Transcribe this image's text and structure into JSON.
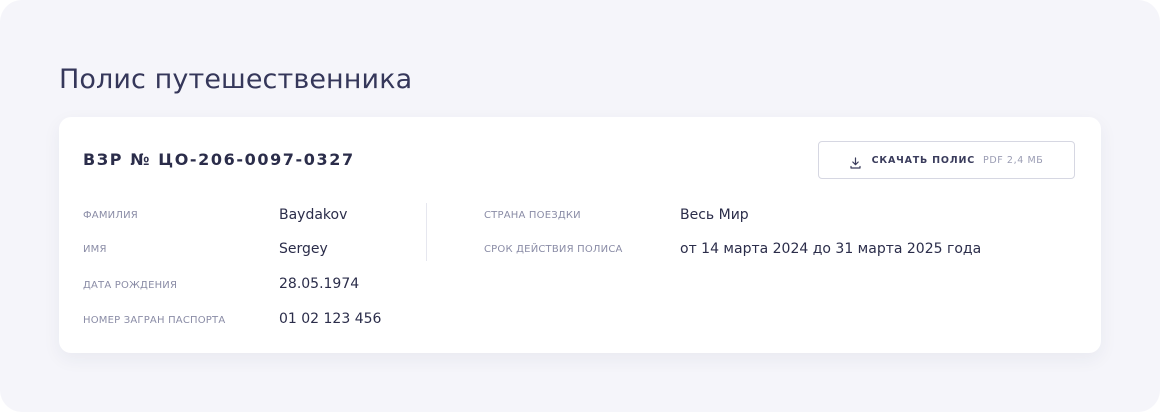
{
  "page": {
    "title": "Полис путешественника"
  },
  "policy": {
    "number": "ВЗР № ЦО-206-0097-0327",
    "download": {
      "label": "СКАЧАТЬ ПОЛИС",
      "meta": "PDF 2,4 МБ",
      "icon": "download-icon"
    },
    "left_fields": [
      {
        "label": "ФАМИЛИЯ",
        "value": "Baydakov"
      },
      {
        "label": "ИМЯ",
        "value": "Sergey"
      },
      {
        "label": "ДАТА РОЖДЕНИЯ",
        "value": "28.05.1974"
      },
      {
        "label": "НОМЕР ЗАГРАН ПАСПОРТА",
        "value": "01 02 123 456"
      }
    ],
    "right_fields": [
      {
        "label": "СТРАНА ПОЕЗДКИ",
        "value": "Весь Мир"
      },
      {
        "label": "СРОК ДЕЙСТВИЯ ПОЛИСА",
        "value": "от 14 марта 2024 до 31 марта 2025 года"
      }
    ]
  },
  "colors": {
    "background": "#f5f5fa",
    "card": "#ffffff",
    "text_primary": "#2b2d4a",
    "text_muted": "#8a8ca6",
    "border": "#d6d7e2"
  }
}
